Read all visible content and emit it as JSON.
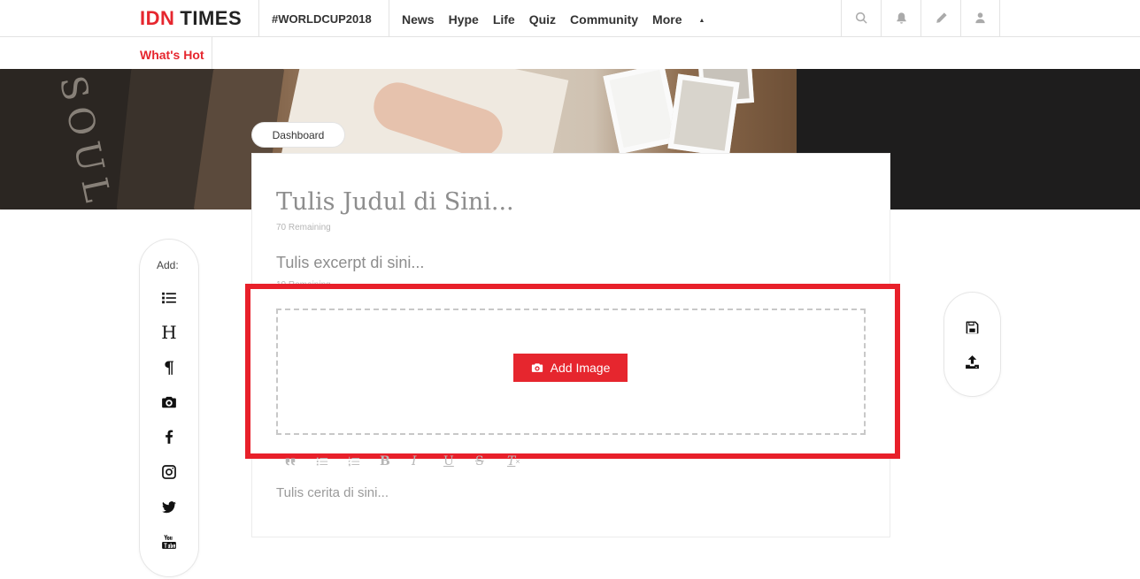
{
  "header": {
    "logo_idn": "IDN",
    "logo_times": "TIMES",
    "hashtag": "#WORLDCUP2018",
    "nav": [
      "News",
      "Hype",
      "Life",
      "Quiz",
      "Community"
    ],
    "more_label": "More",
    "icons": [
      "search-icon",
      "bell-icon",
      "pencil-icon",
      "user-icon"
    ]
  },
  "subnav": {
    "whats_hot": "What's Hot"
  },
  "editor": {
    "breadcrumb": "Dashboard",
    "title_placeholder": "Tulis Judul di Sini...",
    "title_remaining": "70 Remaining",
    "excerpt_placeholder": "Tulis excerpt di sini...",
    "excerpt_remaining": "10 Remaining",
    "add_image_label": "Add Image",
    "story_placeholder": "Tulis cerita di sini...",
    "format_toolbar": [
      "quote-icon",
      "bulleted-list-icon",
      "numbered-list-icon",
      "bold-icon",
      "italic-icon",
      "underline-icon",
      "strikethrough-icon",
      "clear-format-icon"
    ],
    "format_labels": {
      "bold": "B",
      "italic": "I",
      "underline": "U",
      "strike": "S",
      "clear": "T"
    }
  },
  "add_panel": {
    "label": "Add:",
    "items": [
      "list-icon",
      "heading-icon",
      "paragraph-icon",
      "camera-icon",
      "facebook-icon",
      "instagram-icon",
      "twitter-icon",
      "youtube-icon"
    ],
    "heading_glyph": "H",
    "paragraph_glyph": "¶"
  },
  "action_panel": {
    "items": [
      "save-icon",
      "upload-icon"
    ]
  },
  "colors": {
    "brand_red": "#e6262e",
    "highlight_red": "#e8202a"
  }
}
